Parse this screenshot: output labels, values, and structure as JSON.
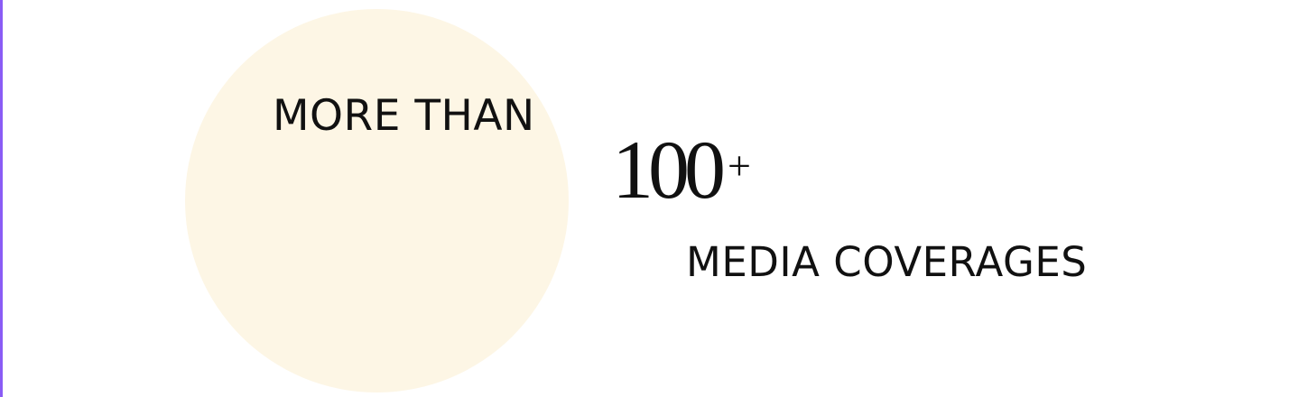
{
  "stat": {
    "lead_text": "MORE THAN",
    "number": "100",
    "suffix": "+",
    "label": "MEDIA COVERAGES"
  },
  "colors": {
    "accent_bar": "#8a5cf5",
    "circle_fill": "#fdf6e5",
    "text": "#111111",
    "background": "#ffffff"
  }
}
